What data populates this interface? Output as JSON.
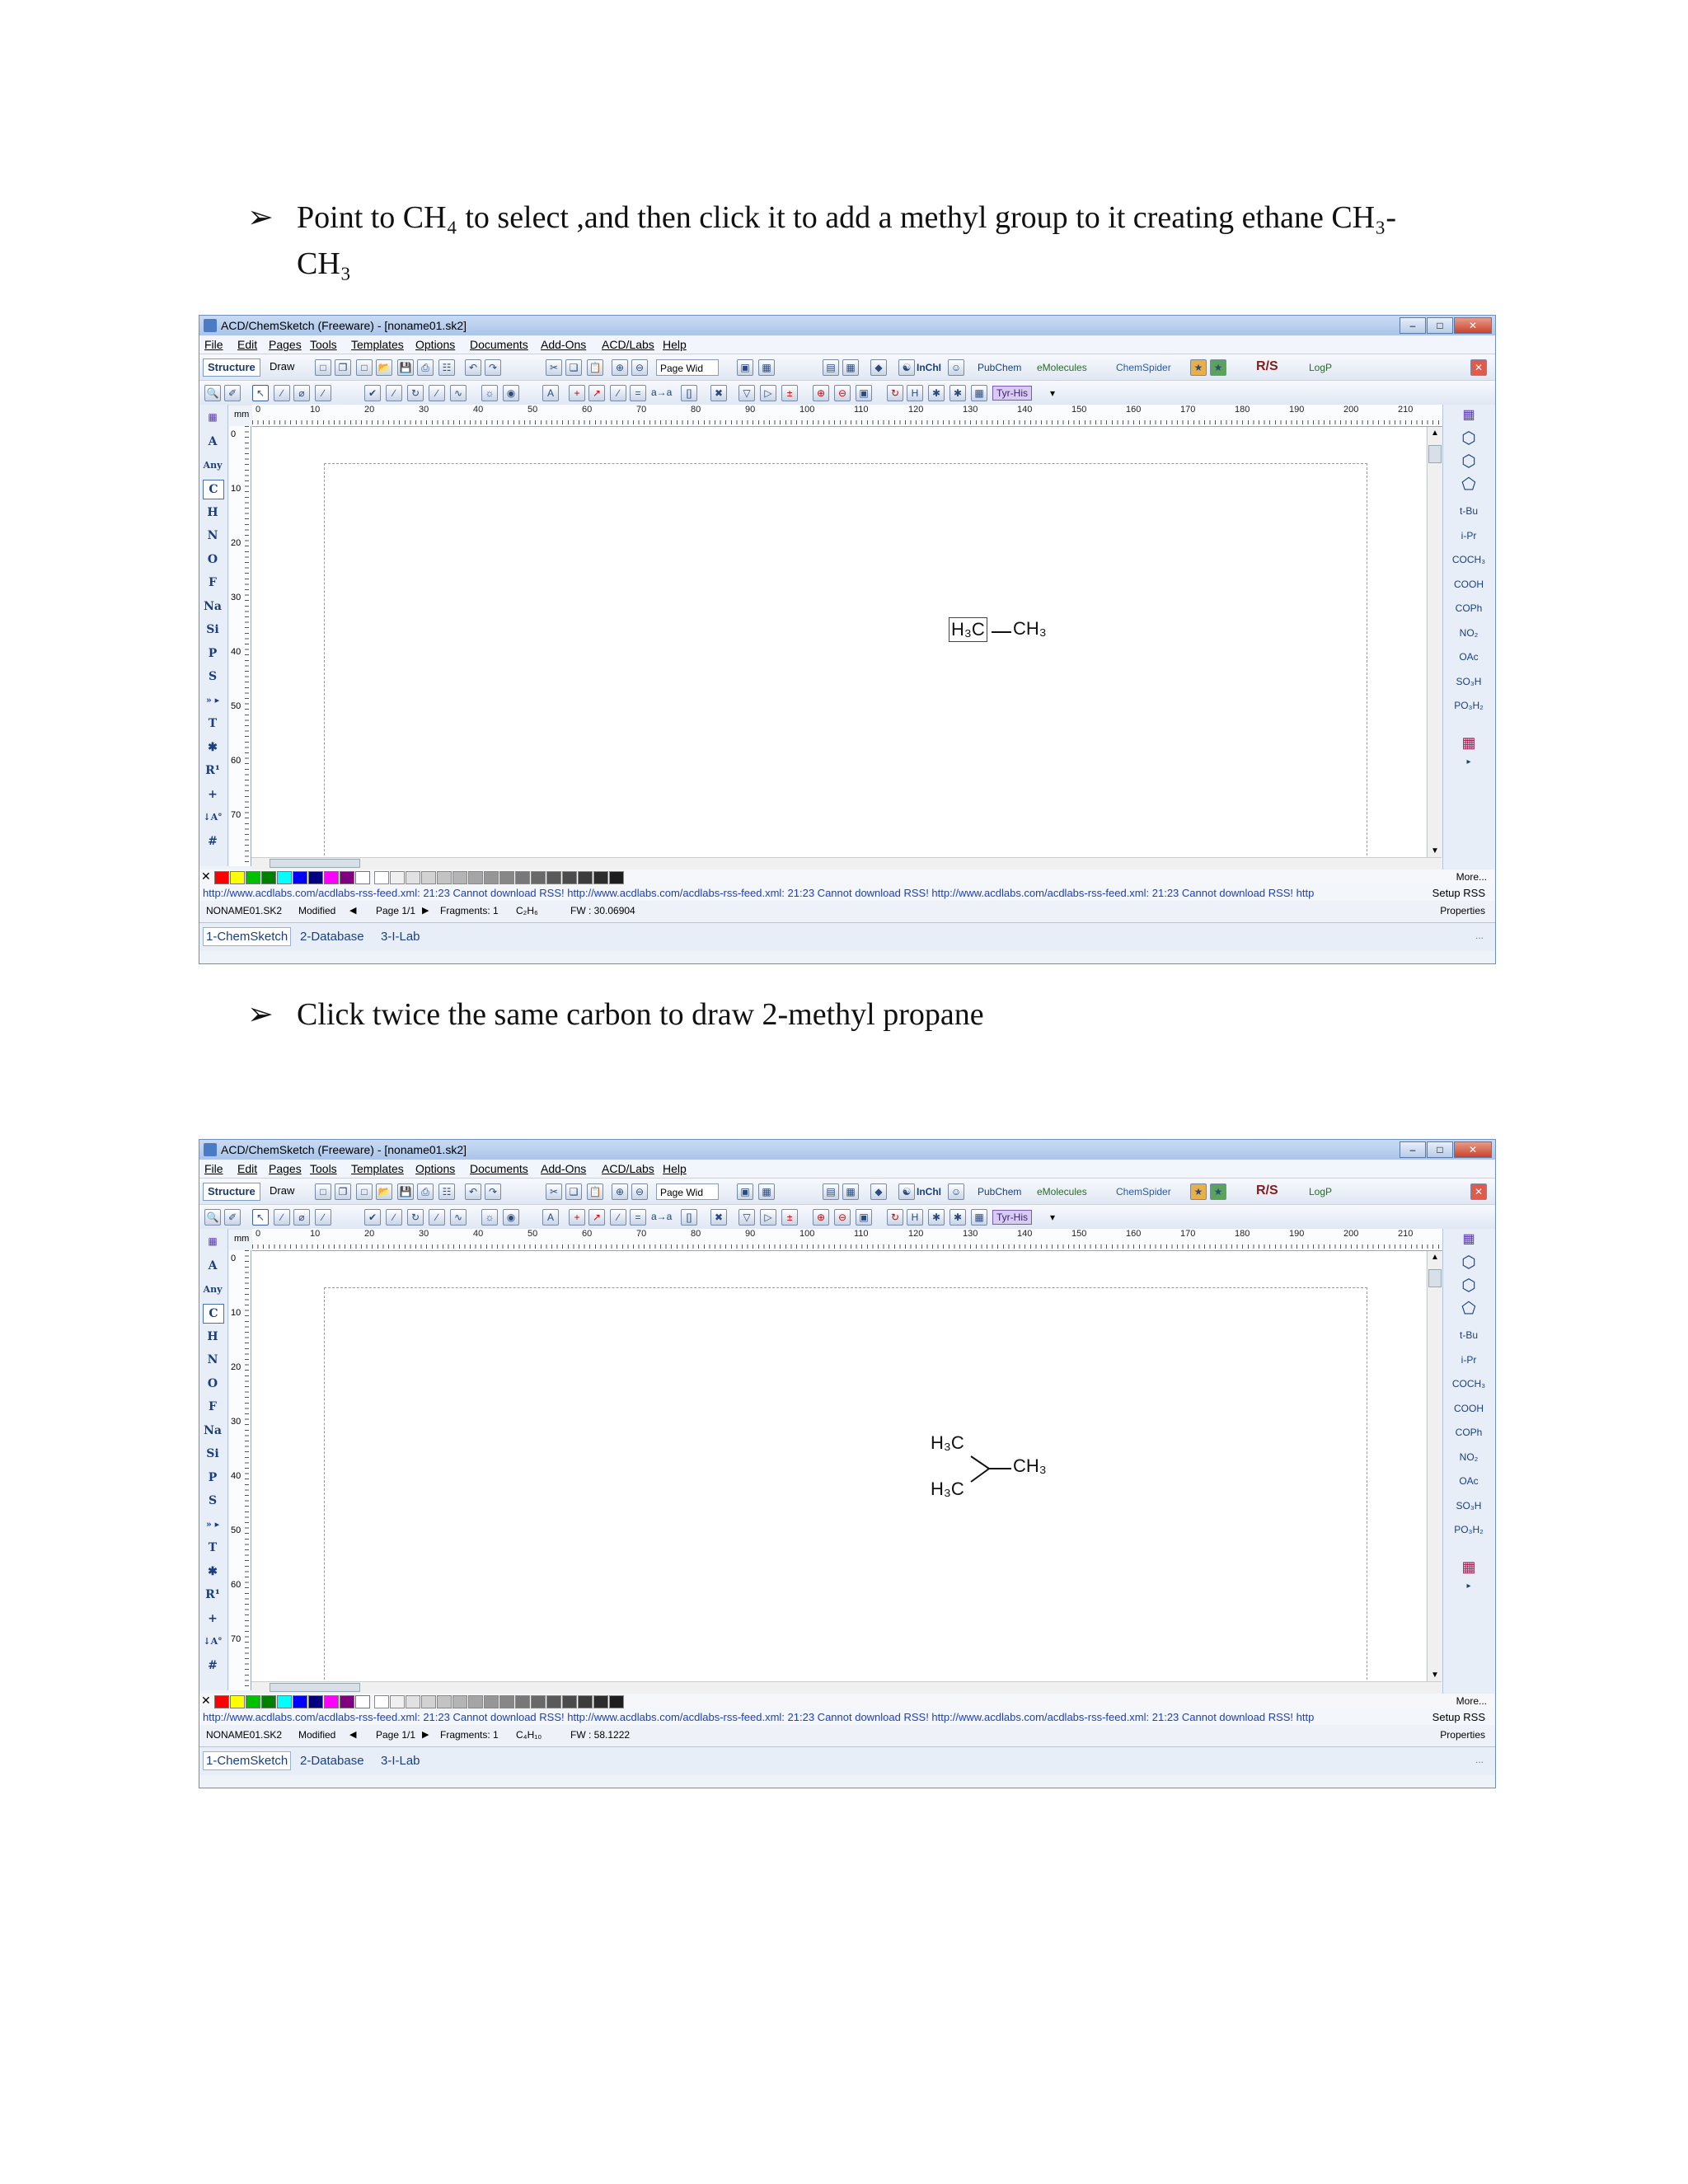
{
  "steps": [
    {
      "line1": "Point to CH₄ to select ,and then click it to add a methyl group to it creating ethane CH₃-",
      "line2": "CH₃"
    },
    {
      "line1": "Click twice the same carbon to draw 2-methyl propane",
      "line2": ""
    }
  ],
  "app": {
    "title": "ACD/ChemSketch (Freeware) - [noname01.sk2]",
    "window_buttons": [
      "–",
      "□",
      "✕"
    ],
    "menu": [
      "File",
      "Edit",
      "Pages",
      "Tools",
      "Templates",
      "Options",
      "Documents",
      "Add-Ons",
      "ACD/Labs",
      "Help"
    ],
    "mode_tabs": [
      "Structure",
      "Draw"
    ],
    "zoom_combo": "Page Wid",
    "toolbar_labels": {
      "inchi": "InChI",
      "pubchem": "PubChem",
      "emolecules": "eMolecules",
      "chemspider": "ChemSpider",
      "rs": "R/S",
      "logp": "LogP",
      "tyr_his": "Tyr-His",
      "arrow_atoms": "a→a"
    },
    "ruler_unit": "mm",
    "ruler_h": [
      "0",
      "10",
      "20",
      "30",
      "40",
      "50",
      "60",
      "70",
      "80",
      "90",
      "100",
      "110",
      "120",
      "130",
      "140",
      "150",
      "160",
      "170",
      "180",
      "190",
      "200",
      "210",
      "2"
    ],
    "ruler_v": [
      "0",
      "10",
      "20",
      "30",
      "40",
      "50",
      "60",
      "70"
    ],
    "elements": [
      "A",
      "Any",
      "C",
      "H",
      "N",
      "O",
      "F",
      "Na",
      "Si",
      "P",
      "S",
      "» ▸",
      "T",
      "✱",
      "R¹",
      "+",
      "↓A°",
      "#"
    ],
    "right_groups": [
      "t-Bu",
      "i-Pr",
      "COCH₃",
      "COOH",
      "COPh",
      "NO₂",
      "OAc",
      "SO₃H",
      "PO₃H₂"
    ],
    "palette_more": "More...",
    "colors": [
      "#ff0000",
      "#ffff00",
      "#00c000",
      "#008000",
      "#00ffff",
      "#0000ff",
      "#000080",
      "#ff00ff",
      "#800080",
      "#ffffff"
    ],
    "rss_text": "http://www.acdlabs.com/acdlabs-rss-feed.xml: 21:23 Cannot download RSS!  http://www.acdlabs.com/acdlabs-rss-feed.xml: 21:23 Cannot download RSS!  http://www.acdlabs.com/acdlabs-rss-feed.xml: 21:23 Cannot download RSS!  http",
    "setup_rss": "Setup RSS",
    "properties": "Properties",
    "app_tabs": [
      "1-ChemSketch",
      "2-Database",
      "3-I-Lab"
    ],
    "more_dots": "..."
  },
  "screens": [
    {
      "filename": "NONAME01.SK2",
      "modified": "Modified",
      "page": "Page 1/1",
      "fragments": "Fragments: 1",
      "formula": "C₂H₆",
      "fw": "FW : 30.06904",
      "molecule": {
        "a1": "H₃C",
        "a2": "CH₃"
      }
    },
    {
      "filename": "NONAME01.SK2",
      "modified": "Modified",
      "page": "Page 1/1",
      "fragments": "Fragments: 1",
      "formula": "C₄H₁₀",
      "fw": "FW : 58.1222",
      "molecule": {
        "a1": "H₃C",
        "a2": "CH₃",
        "a3": "H₃C"
      }
    }
  ]
}
